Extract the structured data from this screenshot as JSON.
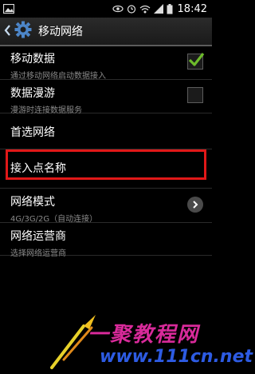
{
  "status_bar": {
    "time": "18:42",
    "icons": [
      "image-icon",
      "eye-icon",
      "alarm-icon",
      "wifi-icon",
      "signal-icon",
      "battery-icon"
    ]
  },
  "action_bar": {
    "title": "移动网络",
    "icons": [
      "back-arrow-icon",
      "gear-icon"
    ]
  },
  "settings": [
    {
      "title": "移动数据",
      "subtitle": "通过移动网络启动数据接入",
      "control": "checkbox",
      "checked": true
    },
    {
      "title": "数据漫游",
      "subtitle": "漫游时连接数据服务",
      "control": "checkbox",
      "checked": false
    },
    {
      "title": "首选网络"
    },
    {
      "title": "接入点名称",
      "highlighted": true
    },
    {
      "title": "网络模式",
      "subtitle": "4G/3G/2G（自动连接）",
      "control": "chevron"
    },
    {
      "title": "网络运营商",
      "subtitle": "选择网络运营商"
    }
  ],
  "watermark": {
    "line1": "一聚教程网",
    "line2": "www.111cn.net"
  },
  "colors": {
    "background": "#000000",
    "accent_check": "#6dbb2b",
    "highlight_border": "#e01818",
    "watermark_pink": "#d82a9a",
    "watermark_blue": "#2d5be3"
  }
}
